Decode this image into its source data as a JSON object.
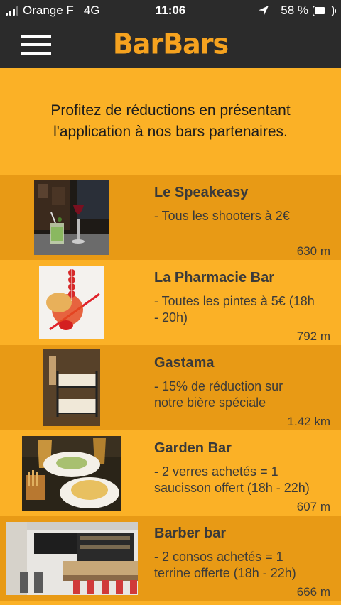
{
  "status_bar": {
    "carrier": "Orange F",
    "network": "4G",
    "time": "11:06",
    "battery_text": "58 %",
    "battery_level": 0.58,
    "signal_bars_active": 3,
    "signal_bars_total": 4
  },
  "header": {
    "app_name": "BarBars",
    "menu_icon": "hamburger-icon"
  },
  "intro": {
    "text": "Profitez de réductions en présentant l'application à nos bars partenaires."
  },
  "bars": [
    {
      "name": "Le Speakeasy",
      "offer": "- Tous les shooters à 2€",
      "distance": "630 m"
    },
    {
      "name": "La Pharmacie Bar",
      "offer": "- Toutes les pintes à 5€ (18h - 20h)",
      "distance": "792 m"
    },
    {
      "name": "Gastama",
      "offer": "- 15% de réduction sur notre bière spéciale",
      "distance": "1.42 km"
    },
    {
      "name": "Garden Bar",
      "offer": "- 2 verres achetés = 1 saucisson offert (18h - 22h)",
      "distance": "607 m"
    },
    {
      "name": "Barber bar",
      "offer": "- 2 consos achetés = 1 terrine offerte (18h - 22h)",
      "distance": "666 m"
    }
  ],
  "colors": {
    "accent": "#f5a21f",
    "background": "#fbb126",
    "row_dark": "#e89a15",
    "header_bg": "#2b2b2b"
  }
}
